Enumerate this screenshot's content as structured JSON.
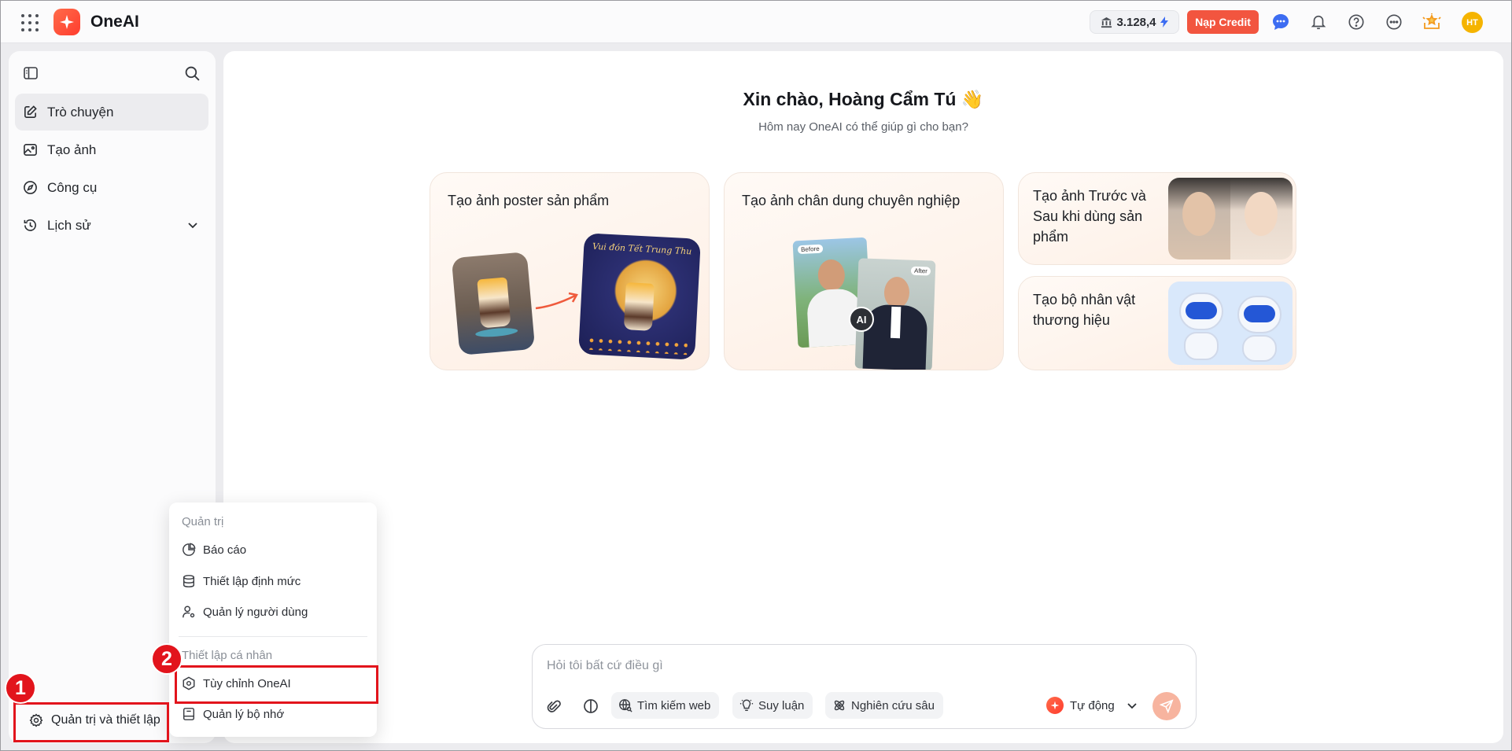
{
  "topbar": {
    "brand": "OneAI",
    "credits": "3.128,4",
    "topup_label": "Nạp Credit",
    "user_initials": "HT"
  },
  "sidebar": {
    "items": [
      {
        "label": "Trò chuyện",
        "icon": "edit-icon"
      },
      {
        "label": "Tạo ảnh",
        "icon": "image-edit-icon"
      },
      {
        "label": "Công cụ",
        "icon": "compass-icon"
      },
      {
        "label": "Lịch sử",
        "icon": "history-icon"
      }
    ],
    "admin_label": "Quản trị và thiết lập"
  },
  "main": {
    "greeting": "Xin chào, Hoàng Cẩm Tú 👋",
    "subtitle": "Hôm nay OneAI có thể giúp gì cho bạn?",
    "cards": [
      {
        "title": "Tạo ảnh poster sản phẩm",
        "poster_text": "Vui đón Tết Trung Thu"
      },
      {
        "title": "Tạo ảnh chân dung chuyên nghiệp",
        "badge": "AI",
        "tag_before": "Before",
        "tag_after": "After"
      },
      {
        "title": "Tạo ảnh Trước và Sau khi dùng sản phẩm"
      },
      {
        "title": "Tạo bộ nhân vật thương hiệu"
      }
    ]
  },
  "chat": {
    "placeholder": "Hỏi tôi bất cứ điều gì",
    "chips": [
      "Tìm kiếm web",
      "Suy luận",
      "Nghiên cứu sâu"
    ],
    "mode": "Tự động"
  },
  "menu": {
    "section_admin": "Quản trị",
    "admin_items": [
      "Báo cáo",
      "Thiết lập định mức",
      "Quản lý người dùng"
    ],
    "section_personal": "Thiết lập cá nhân",
    "personal_items": [
      "Tùy chỉnh OneAI",
      "Quản lý bộ nhớ"
    ]
  },
  "annotations": {
    "step1": "1",
    "step2": "2",
    "color": "#e2141c"
  }
}
